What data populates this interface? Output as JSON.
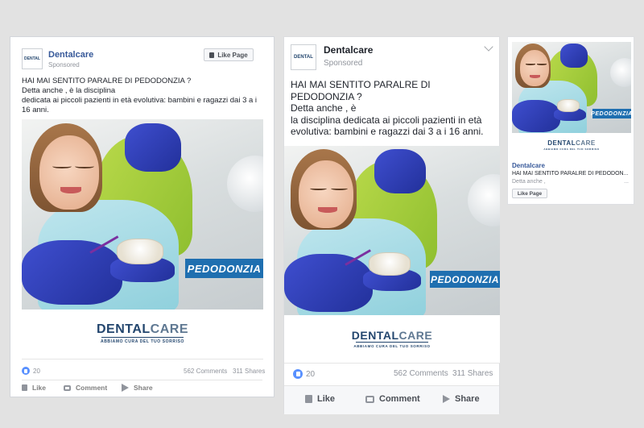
{
  "brand": {
    "page_name": "Dentalcare",
    "sponsored": "Sponsored",
    "logo_small": "DENTAL",
    "accent": "#23466e",
    "label_blue": "#1f6fb0"
  },
  "post": {
    "text_line1": "HAI MAI SENTITO PARALRE DI PEDODONZIA ?",
    "text_line2": "Detta anche  , è la disciplina",
    "text_line3": "dedicata ai piccoli pazienti in età evolutiva: bambini e ragazzi dai 3 a i 16 anni.",
    "mobile_line2": "Detta anche  , è",
    "mobile_line3": "la disciplina dedicata ai piccoli pazienti in età evolutiva: bambini e ragazzi dai 3 a i 16 anni."
  },
  "image": {
    "label": "PEDODONZIA",
    "logo_dental": "DENTAL",
    "logo_care": "CARE",
    "tagline": "ABBIAMO CURA DEL TUO SORRISO"
  },
  "stats": {
    "likes": "20",
    "comments": "562 Comments",
    "shares": "311 Shares"
  },
  "actions": {
    "like": "Like",
    "comment": "Comment",
    "share": "Share",
    "like_page": "Like Page"
  },
  "right_column": {
    "title": "Dentalcare",
    "headline": "HAI MAI SENTITO PARALRE DI PEDODON...",
    "desc": "Detta anche ,",
    "ellipsis": "..."
  }
}
